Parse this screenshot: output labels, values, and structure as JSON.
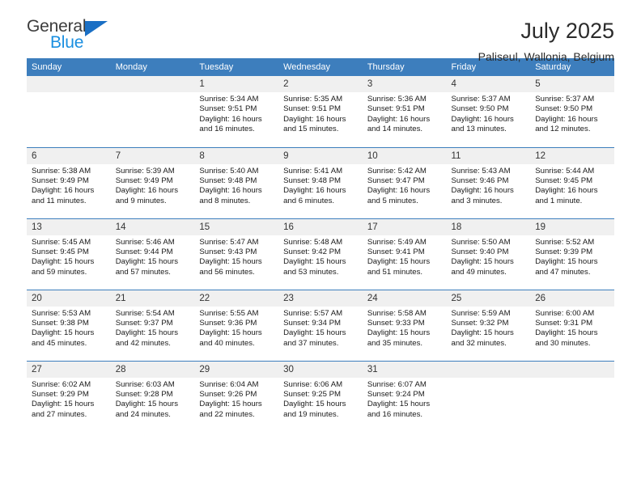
{
  "brand": {
    "name_part1": "General",
    "name_part2": "Blue",
    "accent_color": "#1a8fe0",
    "triangle_color": "#1a6fc4"
  },
  "header": {
    "title": "July 2025",
    "subtitle": "Paliseul, Wallonia, Belgium"
  },
  "theme": {
    "header_bg": "#3d7ebd",
    "header_text": "#ffffff",
    "daynum_bg": "#f0f0f0",
    "row_divider": "#3d7ebd"
  },
  "weekdays": [
    "Sunday",
    "Monday",
    "Tuesday",
    "Wednesday",
    "Thursday",
    "Friday",
    "Saturday"
  ],
  "labels": {
    "sunrise_prefix": "Sunrise:",
    "sunset_prefix": "Sunset:",
    "daylight_prefix": "Daylight:"
  },
  "weeks": [
    [
      {
        "day": "",
        "empty": true,
        "line1": "",
        "line2": "",
        "line3": "",
        "line4": ""
      },
      {
        "day": "",
        "empty": true,
        "line1": "",
        "line2": "",
        "line3": "",
        "line4": ""
      },
      {
        "day": "1",
        "line1": "Sunrise: 5:34 AM",
        "line2": "Sunset: 9:51 PM",
        "line3": "Daylight: 16 hours",
        "line4": "and 16 minutes."
      },
      {
        "day": "2",
        "line1": "Sunrise: 5:35 AM",
        "line2": "Sunset: 9:51 PM",
        "line3": "Daylight: 16 hours",
        "line4": "and 15 minutes."
      },
      {
        "day": "3",
        "line1": "Sunrise: 5:36 AM",
        "line2": "Sunset: 9:51 PM",
        "line3": "Daylight: 16 hours",
        "line4": "and 14 minutes."
      },
      {
        "day": "4",
        "line1": "Sunrise: 5:37 AM",
        "line2": "Sunset: 9:50 PM",
        "line3": "Daylight: 16 hours",
        "line4": "and 13 minutes."
      },
      {
        "day": "5",
        "line1": "Sunrise: 5:37 AM",
        "line2": "Sunset: 9:50 PM",
        "line3": "Daylight: 16 hours",
        "line4": "and 12 minutes."
      }
    ],
    [
      {
        "day": "6",
        "line1": "Sunrise: 5:38 AM",
        "line2": "Sunset: 9:49 PM",
        "line3": "Daylight: 16 hours",
        "line4": "and 11 minutes."
      },
      {
        "day": "7",
        "line1": "Sunrise: 5:39 AM",
        "line2": "Sunset: 9:49 PM",
        "line3": "Daylight: 16 hours",
        "line4": "and 9 minutes."
      },
      {
        "day": "8",
        "line1": "Sunrise: 5:40 AM",
        "line2": "Sunset: 9:48 PM",
        "line3": "Daylight: 16 hours",
        "line4": "and 8 minutes."
      },
      {
        "day": "9",
        "line1": "Sunrise: 5:41 AM",
        "line2": "Sunset: 9:48 PM",
        "line3": "Daylight: 16 hours",
        "line4": "and 6 minutes."
      },
      {
        "day": "10",
        "line1": "Sunrise: 5:42 AM",
        "line2": "Sunset: 9:47 PM",
        "line3": "Daylight: 16 hours",
        "line4": "and 5 minutes."
      },
      {
        "day": "11",
        "line1": "Sunrise: 5:43 AM",
        "line2": "Sunset: 9:46 PM",
        "line3": "Daylight: 16 hours",
        "line4": "and 3 minutes."
      },
      {
        "day": "12",
        "line1": "Sunrise: 5:44 AM",
        "line2": "Sunset: 9:45 PM",
        "line3": "Daylight: 16 hours",
        "line4": "and 1 minute."
      }
    ],
    [
      {
        "day": "13",
        "line1": "Sunrise: 5:45 AM",
        "line2": "Sunset: 9:45 PM",
        "line3": "Daylight: 15 hours",
        "line4": "and 59 minutes."
      },
      {
        "day": "14",
        "line1": "Sunrise: 5:46 AM",
        "line2": "Sunset: 9:44 PM",
        "line3": "Daylight: 15 hours",
        "line4": "and 57 minutes."
      },
      {
        "day": "15",
        "line1": "Sunrise: 5:47 AM",
        "line2": "Sunset: 9:43 PM",
        "line3": "Daylight: 15 hours",
        "line4": "and 56 minutes."
      },
      {
        "day": "16",
        "line1": "Sunrise: 5:48 AM",
        "line2": "Sunset: 9:42 PM",
        "line3": "Daylight: 15 hours",
        "line4": "and 53 minutes."
      },
      {
        "day": "17",
        "line1": "Sunrise: 5:49 AM",
        "line2": "Sunset: 9:41 PM",
        "line3": "Daylight: 15 hours",
        "line4": "and 51 minutes."
      },
      {
        "day": "18",
        "line1": "Sunrise: 5:50 AM",
        "line2": "Sunset: 9:40 PM",
        "line3": "Daylight: 15 hours",
        "line4": "and 49 minutes."
      },
      {
        "day": "19",
        "line1": "Sunrise: 5:52 AM",
        "line2": "Sunset: 9:39 PM",
        "line3": "Daylight: 15 hours",
        "line4": "and 47 minutes."
      }
    ],
    [
      {
        "day": "20",
        "line1": "Sunrise: 5:53 AM",
        "line2": "Sunset: 9:38 PM",
        "line3": "Daylight: 15 hours",
        "line4": "and 45 minutes."
      },
      {
        "day": "21",
        "line1": "Sunrise: 5:54 AM",
        "line2": "Sunset: 9:37 PM",
        "line3": "Daylight: 15 hours",
        "line4": "and 42 minutes."
      },
      {
        "day": "22",
        "line1": "Sunrise: 5:55 AM",
        "line2": "Sunset: 9:36 PM",
        "line3": "Daylight: 15 hours",
        "line4": "and 40 minutes."
      },
      {
        "day": "23",
        "line1": "Sunrise: 5:57 AM",
        "line2": "Sunset: 9:34 PM",
        "line3": "Daylight: 15 hours",
        "line4": "and 37 minutes."
      },
      {
        "day": "24",
        "line1": "Sunrise: 5:58 AM",
        "line2": "Sunset: 9:33 PM",
        "line3": "Daylight: 15 hours",
        "line4": "and 35 minutes."
      },
      {
        "day": "25",
        "line1": "Sunrise: 5:59 AM",
        "line2": "Sunset: 9:32 PM",
        "line3": "Daylight: 15 hours",
        "line4": "and 32 minutes."
      },
      {
        "day": "26",
        "line1": "Sunrise: 6:00 AM",
        "line2": "Sunset: 9:31 PM",
        "line3": "Daylight: 15 hours",
        "line4": "and 30 minutes."
      }
    ],
    [
      {
        "day": "27",
        "line1": "Sunrise: 6:02 AM",
        "line2": "Sunset: 9:29 PM",
        "line3": "Daylight: 15 hours",
        "line4": "and 27 minutes."
      },
      {
        "day": "28",
        "line1": "Sunrise: 6:03 AM",
        "line2": "Sunset: 9:28 PM",
        "line3": "Daylight: 15 hours",
        "line4": "and 24 minutes."
      },
      {
        "day": "29",
        "line1": "Sunrise: 6:04 AM",
        "line2": "Sunset: 9:26 PM",
        "line3": "Daylight: 15 hours",
        "line4": "and 22 minutes."
      },
      {
        "day": "30",
        "line1": "Sunrise: 6:06 AM",
        "line2": "Sunset: 9:25 PM",
        "line3": "Daylight: 15 hours",
        "line4": "and 19 minutes."
      },
      {
        "day": "31",
        "line1": "Sunrise: 6:07 AM",
        "line2": "Sunset: 9:24 PM",
        "line3": "Daylight: 15 hours",
        "line4": "and 16 minutes."
      },
      {
        "day": "",
        "empty": true,
        "line1": "",
        "line2": "",
        "line3": "",
        "line4": ""
      },
      {
        "day": "",
        "empty": true,
        "line1": "",
        "line2": "",
        "line3": "",
        "line4": ""
      }
    ]
  ]
}
